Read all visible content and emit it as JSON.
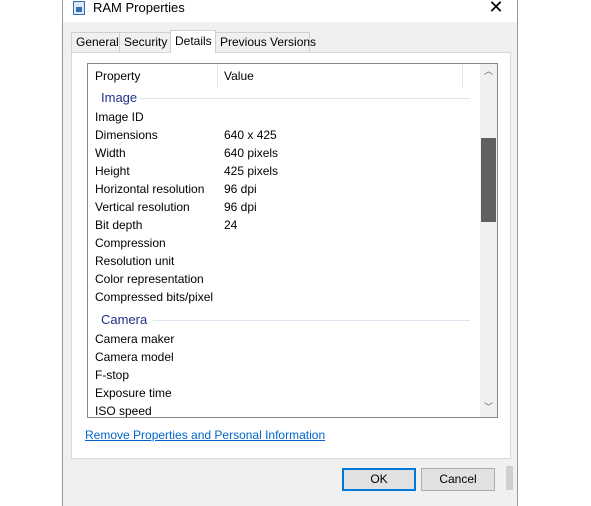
{
  "window": {
    "title": "RAM Properties",
    "close_glyph": "✕",
    "title_icon": "file-properties-icon"
  },
  "tabs": [
    {
      "label": "General",
      "active": false
    },
    {
      "label": "Security",
      "active": false
    },
    {
      "label": "Details",
      "active": true
    },
    {
      "label": "Previous Versions",
      "active": false
    }
  ],
  "list": {
    "header_property": "Property",
    "header_value": "Value",
    "groups": [
      {
        "name": "Image",
        "rows": [
          {
            "property": "Image ID",
            "value": ""
          },
          {
            "property": "Dimensions",
            "value": "640 x 425"
          },
          {
            "property": "Width",
            "value": "640 pixels"
          },
          {
            "property": "Height",
            "value": "425 pixels"
          },
          {
            "property": "Horizontal resolution",
            "value": "96 dpi"
          },
          {
            "property": "Vertical resolution",
            "value": "96 dpi"
          },
          {
            "property": "Bit depth",
            "value": "24"
          },
          {
            "property": "Compression",
            "value": ""
          },
          {
            "property": "Resolution unit",
            "value": ""
          },
          {
            "property": "Color representation",
            "value": ""
          },
          {
            "property": "Compressed bits/pixel",
            "value": ""
          }
        ]
      },
      {
        "name": "Camera",
        "rows": [
          {
            "property": "Camera maker",
            "value": ""
          },
          {
            "property": "Camera model",
            "value": ""
          },
          {
            "property": "F-stop",
            "value": ""
          },
          {
            "property": "Exposure time",
            "value": ""
          },
          {
            "property": "ISO speed",
            "value": ""
          }
        ]
      }
    ],
    "scroll_up_glyph": "︿",
    "scroll_down_glyph": "﹀"
  },
  "remove_link": "Remove Properties and Personal Information",
  "buttons": {
    "ok": "OK",
    "cancel": "Cancel"
  },
  "colors": {
    "group_header": "#1e3287",
    "link": "#0066cc",
    "default_button_border": "#0078d7"
  }
}
